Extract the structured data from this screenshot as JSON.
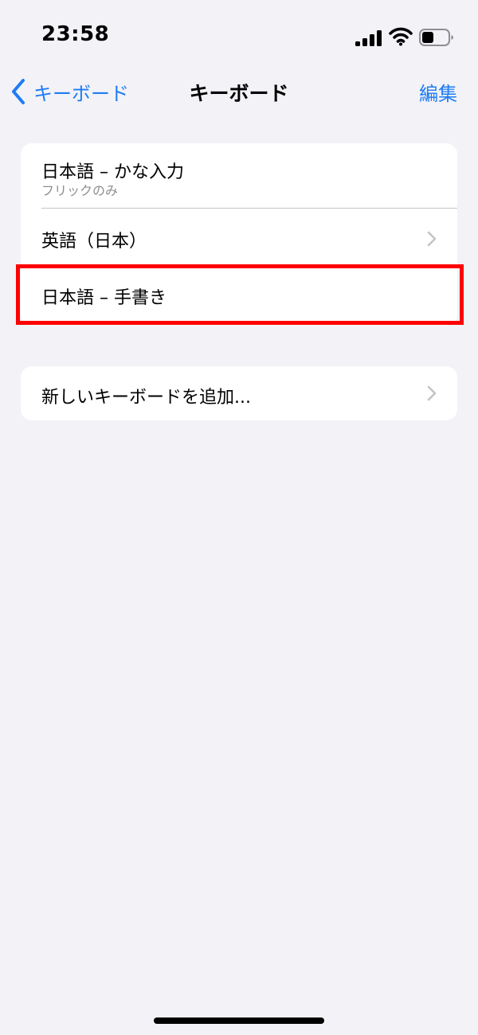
{
  "status_bar": {
    "time": "23:58",
    "icons": [
      "signal-icon",
      "wifi-icon",
      "battery-icon"
    ],
    "battery_level": 0.45
  },
  "nav": {
    "back_label": "キーボード",
    "title": "キーボード",
    "edit_label": "編集",
    "accent_color": "#1f7cf4"
  },
  "keyboards": [
    {
      "label": "日本語 – かな入力",
      "subtitle": "フリックのみ"
    },
    {
      "label": "英語（日本）"
    },
    {
      "label": "日本語 – 手書き"
    }
  ],
  "add_keyboard": {
    "label": "新しいキーボードを追加..."
  },
  "highlight": {
    "color": "#ff0000"
  }
}
